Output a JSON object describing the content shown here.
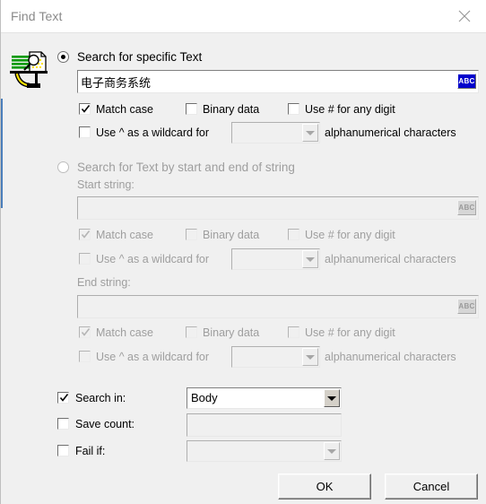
{
  "window": {
    "title": "Find Text",
    "close_icon": "close-icon",
    "accent_color": "#4a7ebb",
    "background": "#f0f0f0",
    "titlebar_background": "#ffffff"
  },
  "find_icon": {
    "name": "find-text-scanner-icon",
    "colors": {
      "lines": "#009900",
      "paper": "#ffffff",
      "pencil": "#ffe400",
      "stand": "#000000"
    }
  },
  "mode_specific": {
    "radio_label": "Search for specific Text",
    "radio_selected": true,
    "text_value": "电子商务系统",
    "text_placeholder": "",
    "abc_label": "ABC",
    "options": {
      "match_case": {
        "label": "Match case",
        "checked": true,
        "enabled": true
      },
      "binary_data": {
        "label": "Binary data",
        "checked": false,
        "enabled": true
      },
      "use_hash_digit": {
        "label": "Use # for any digit",
        "checked": false,
        "enabled": true
      },
      "wildcard": {
        "label": "Use ^ as a wildcard for",
        "checked": false,
        "enabled": true
      },
      "wildcard_count_value": "",
      "wildcard_suffix": "alphanumerical characters"
    }
  },
  "mode_startend": {
    "radio_label": "Search for Text by start and end of string",
    "radio_selected": false,
    "enabled": false,
    "start": {
      "caption": "Start string:",
      "value": "",
      "abc_label": "ABC",
      "options": {
        "match_case": {
          "label": "Match case",
          "checked": true
        },
        "binary_data": {
          "label": "Binary data",
          "checked": false
        },
        "use_hash_digit": {
          "label": "Use # for any digit",
          "checked": false
        },
        "wildcard": {
          "label": "Use ^ as a wildcard for",
          "checked": false
        },
        "wildcard_count_value": "",
        "wildcard_suffix": "alphanumerical characters"
      }
    },
    "end": {
      "caption": "End string:",
      "value": "",
      "abc_label": "ABC",
      "options": {
        "match_case": {
          "label": "Match case",
          "checked": true
        },
        "binary_data": {
          "label": "Binary data",
          "checked": false
        },
        "use_hash_digit": {
          "label": "Use # for any digit",
          "checked": false
        },
        "wildcard": {
          "label": "Use ^ as a wildcard for",
          "checked": false
        },
        "wildcard_count_value": "",
        "wildcard_suffix": "alphanumerical characters"
      }
    }
  },
  "bottom": {
    "search_in": {
      "label": "Search in:",
      "checked": true,
      "value": "Body",
      "enabled": true
    },
    "save_count": {
      "label": "Save count:",
      "checked": false,
      "value": "",
      "enabled": false
    },
    "fail_if": {
      "label": "Fail if:",
      "checked": false,
      "value": "",
      "enabled": false
    }
  },
  "footer": {
    "ok_label": "OK",
    "cancel_label": "Cancel"
  }
}
